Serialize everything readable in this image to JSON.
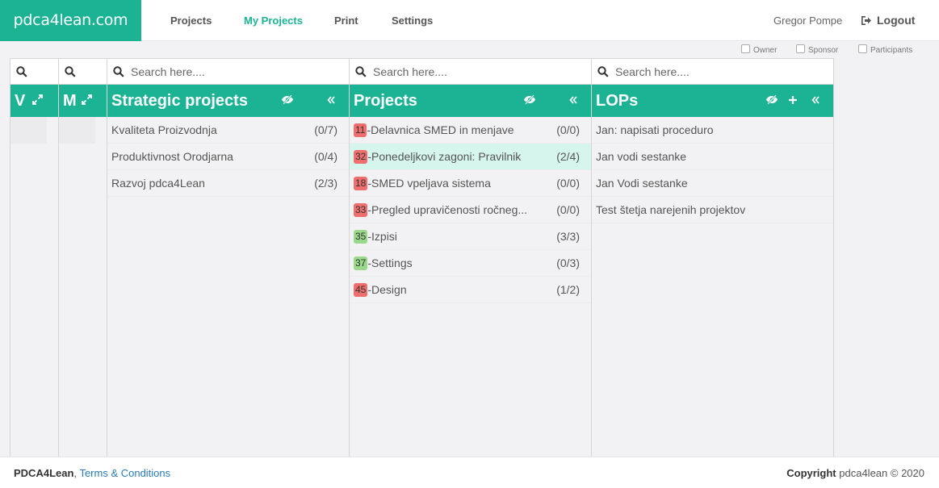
{
  "brand": "pdca4lean.com",
  "nav": {
    "projects": "Projects",
    "my_projects": "My Projects",
    "print": "Print",
    "settings": "Settings"
  },
  "user": {
    "name": "Gregor Pompe",
    "logout": "Logout"
  },
  "filters": {
    "owner": "Owner",
    "sponsor": "Sponsor",
    "participants": "Participants"
  },
  "columns": {
    "v": {
      "title": "V"
    },
    "m": {
      "title": "M"
    },
    "strategic": {
      "placeholder": "Search here....",
      "title": "Strategic projects",
      "items": [
        {
          "label": "Kvaliteta Proizvodnja",
          "count": "(0/7)"
        },
        {
          "label": "Produktivnost Orodjarna",
          "count": "(0/4)"
        },
        {
          "label": "Razvoj pdca4Lean",
          "count": "(2/3)"
        }
      ]
    },
    "projects": {
      "placeholder": "Search here....",
      "title": "Projects",
      "items": [
        {
          "id": "11",
          "status": "red",
          "label": "-Delavnica SMED in menjave",
          "count": "(0/0)"
        },
        {
          "id": "32",
          "status": "red",
          "label": "-Ponedeljkovi zagoni: Pravilnik",
          "count": "(2/4)",
          "selected": true
        },
        {
          "id": "18",
          "status": "red",
          "label": "-SMED vpeljava sistema",
          "count": "(0/0)"
        },
        {
          "id": "33",
          "status": "red",
          "label": "-Pregled upravičenosti ročneg...",
          "count": "(0/0)"
        },
        {
          "id": "35",
          "status": "green",
          "label": "-Izpisi",
          "count": "(3/3)"
        },
        {
          "id": "37",
          "status": "green",
          "label": "-Settings",
          "count": "(0/3)"
        },
        {
          "id": "45",
          "status": "red",
          "label": "-Design",
          "count": "(1/2)"
        }
      ]
    },
    "lops": {
      "placeholder": "Search here....",
      "title": "LOPs",
      "items": [
        {
          "label": "Jan: napisati proceduro"
        },
        {
          "label": "Jan vodi sestanke"
        },
        {
          "label": "Jan Vodi sestanke"
        },
        {
          "label": "Test štetja narejenih projektov"
        }
      ]
    }
  },
  "colors": {
    "accent": "#1bb394",
    "badge_red": "#ef6e6e",
    "badge_green": "#9ad98b",
    "selected_row": "#d6f5ec"
  },
  "footer": {
    "brand": "PDCA4Lean",
    "separator": ",",
    "terms": "Terms & Conditions",
    "copyright_label": "Copyright",
    "copyright_text": "pdca4lean © 2020"
  }
}
